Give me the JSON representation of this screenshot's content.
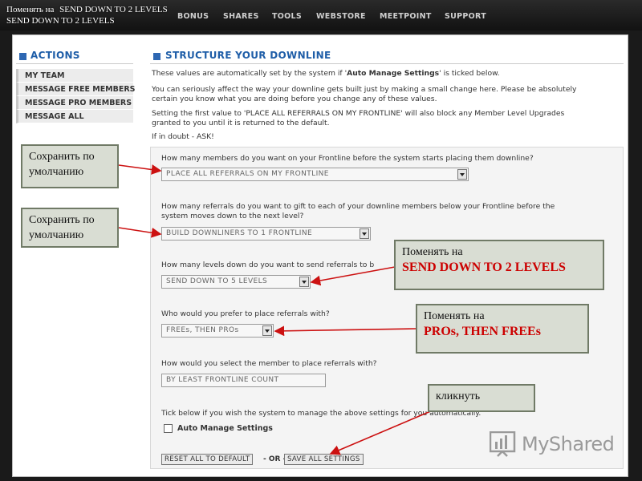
{
  "nav": {
    "items": [
      "BONUS",
      "SHARES",
      "TOOLS",
      "WEBSTORE",
      "MEETPOINT",
      "SUPPORT"
    ]
  },
  "top_overlay": {
    "line1": "Поменять на",
    "line1b": "SEND DOWN TO 2 LEVELS",
    "line2": "SEND DOWN TO 2 LEVELS"
  },
  "sidebar": {
    "title": "ACTIONS",
    "items": [
      "MY TEAM",
      "MESSAGE FREE MEMBERS",
      "MESSAGE PRO MEMBERS",
      "MESSAGE ALL"
    ]
  },
  "main": {
    "title": "STRUCTURE YOUR DOWNLINE",
    "intro1_a": "These values are automatically set by the system if '",
    "intro1_b": "Auto Manage Settings",
    "intro1_c": "' is ticked below.",
    "intro2_a": "You can seriously affect the way your downline gets built just by making a small change here. Please be absolutely",
    "intro2_b": "certain you know what you are doing before you change any of these values.",
    "intro3_a": "Setting the first value to 'PLACE ALL REFERRALS ON MY FRONTLINE' will also block any Member Level Upgrades",
    "intro3_b": "granted to you until it is returned to the default.",
    "intro4": "If in doubt - ASK!"
  },
  "form": {
    "q1": "How many members do you want on your Frontline before the system starts placing them downline?",
    "s1": "PLACE ALL REFERRALS ON MY FRONTLINE",
    "q2a": "How many referrals do you want to gift to each of your downline members below your Frontline before the",
    "q2b": "system moves down to the next level?",
    "s2": "BUILD DOWNLINERS TO 1 FRONTLINE",
    "q3": "How many levels down do you want to send referrals to b",
    "s3": "SEND DOWN TO 5 LEVELS",
    "q4": "Who would you prefer to place referrals with?",
    "s4": "FREEs, THEN PROs",
    "q5": "How would you select the member to place referrals with?",
    "s5": "BY LEAST FRONTLINE COUNT",
    "tick_text": "Tick below if you wish the system to manage the above settings for you automatically.",
    "checkbox_label": "Auto Manage Settings",
    "reset_button": "RESET ALL TO DEFAULT",
    "or_text": "- OR -",
    "save_button": "SAVE ALL SETTINGS"
  },
  "callouts": {
    "c1": "Сохранить по умолчанию",
    "c2": "Сохранить по умолчанию",
    "c3_line1": "Поменять на",
    "c3_line2": "SEND  DOWN  TO 2 LEVELS",
    "c4_line1": "Поменять на",
    "c4_line2": "PROs, THEN  FREEs",
    "c5": "кликнуть"
  },
  "watermark": {
    "text": "MyShared",
    "icon": "myshared-logo-icon"
  },
  "colors": {
    "accent": "#1f5ea8",
    "callout_red": "#cc0000",
    "arrow_red": "#cc1111"
  }
}
